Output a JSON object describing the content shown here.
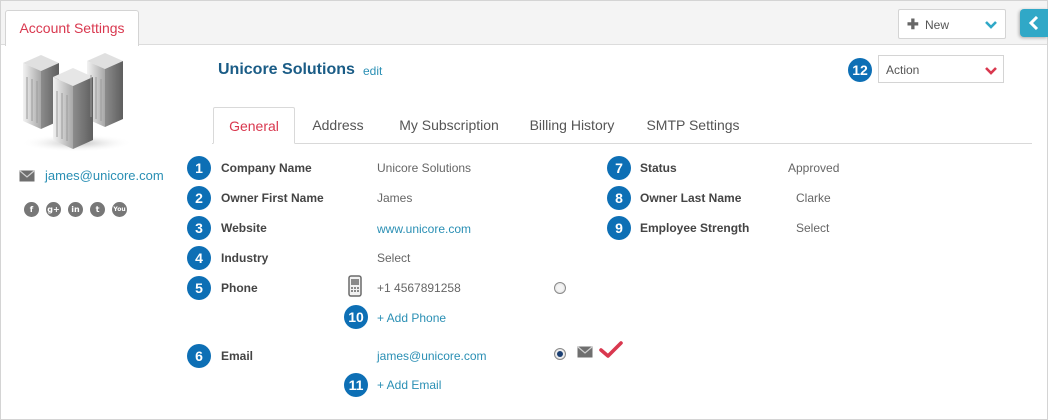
{
  "header": {
    "tab_label": "Account Settings",
    "new_button_label": "New"
  },
  "profile": {
    "email": "james@unicore.com",
    "socials": [
      {
        "name": "facebook-icon",
        "glyph": "f"
      },
      {
        "name": "google-plus-icon",
        "glyph": "g+"
      },
      {
        "name": "linkedin-icon",
        "glyph": "in"
      },
      {
        "name": "twitter-icon",
        "glyph": "t"
      },
      {
        "name": "youtube-icon",
        "glyph": "You"
      }
    ]
  },
  "company": {
    "name": "Unicore Solutions",
    "edit_label": "edit"
  },
  "action_select": {
    "value": "Action"
  },
  "tabs": [
    {
      "label": "General",
      "active": true
    },
    {
      "label": "Address",
      "active": false
    },
    {
      "label": "My Subscription",
      "active": false
    },
    {
      "label": "Billing History",
      "active": false
    },
    {
      "label": "SMTP Settings",
      "active": false
    }
  ],
  "fields": {
    "company_name": {
      "label": "Company Name",
      "value": "Unicore Solutions"
    },
    "owner_first_name": {
      "label": "Owner First Name",
      "value": "James"
    },
    "website": {
      "label": "Website",
      "value": "www.unicore.com"
    },
    "industry": {
      "label": "Industry",
      "value": "Select"
    },
    "phone": {
      "label": "Phone",
      "value": "+1 4567891258"
    },
    "add_phone": "+ Add Phone",
    "email": {
      "label": "Email",
      "value": "james@unicore.com"
    },
    "add_email": "+ Add Email",
    "status": {
      "label": "Status",
      "value": "Approved"
    },
    "owner_last_name": {
      "label": "Owner Last Name",
      "value": "Clarke"
    },
    "employee_strength": {
      "label": "Employee Strength",
      "value": "Select"
    }
  },
  "markers": [
    "1",
    "2",
    "3",
    "4",
    "5",
    "6",
    "7",
    "8",
    "9",
    "10",
    "11",
    "12"
  ],
  "colors": {
    "accent_red": "#d9384f",
    "link_blue": "#2a8fb4",
    "marker_blue": "#0d6fb5",
    "title_blue": "#1a5c86",
    "collapse_teal": "#30a8c7"
  }
}
